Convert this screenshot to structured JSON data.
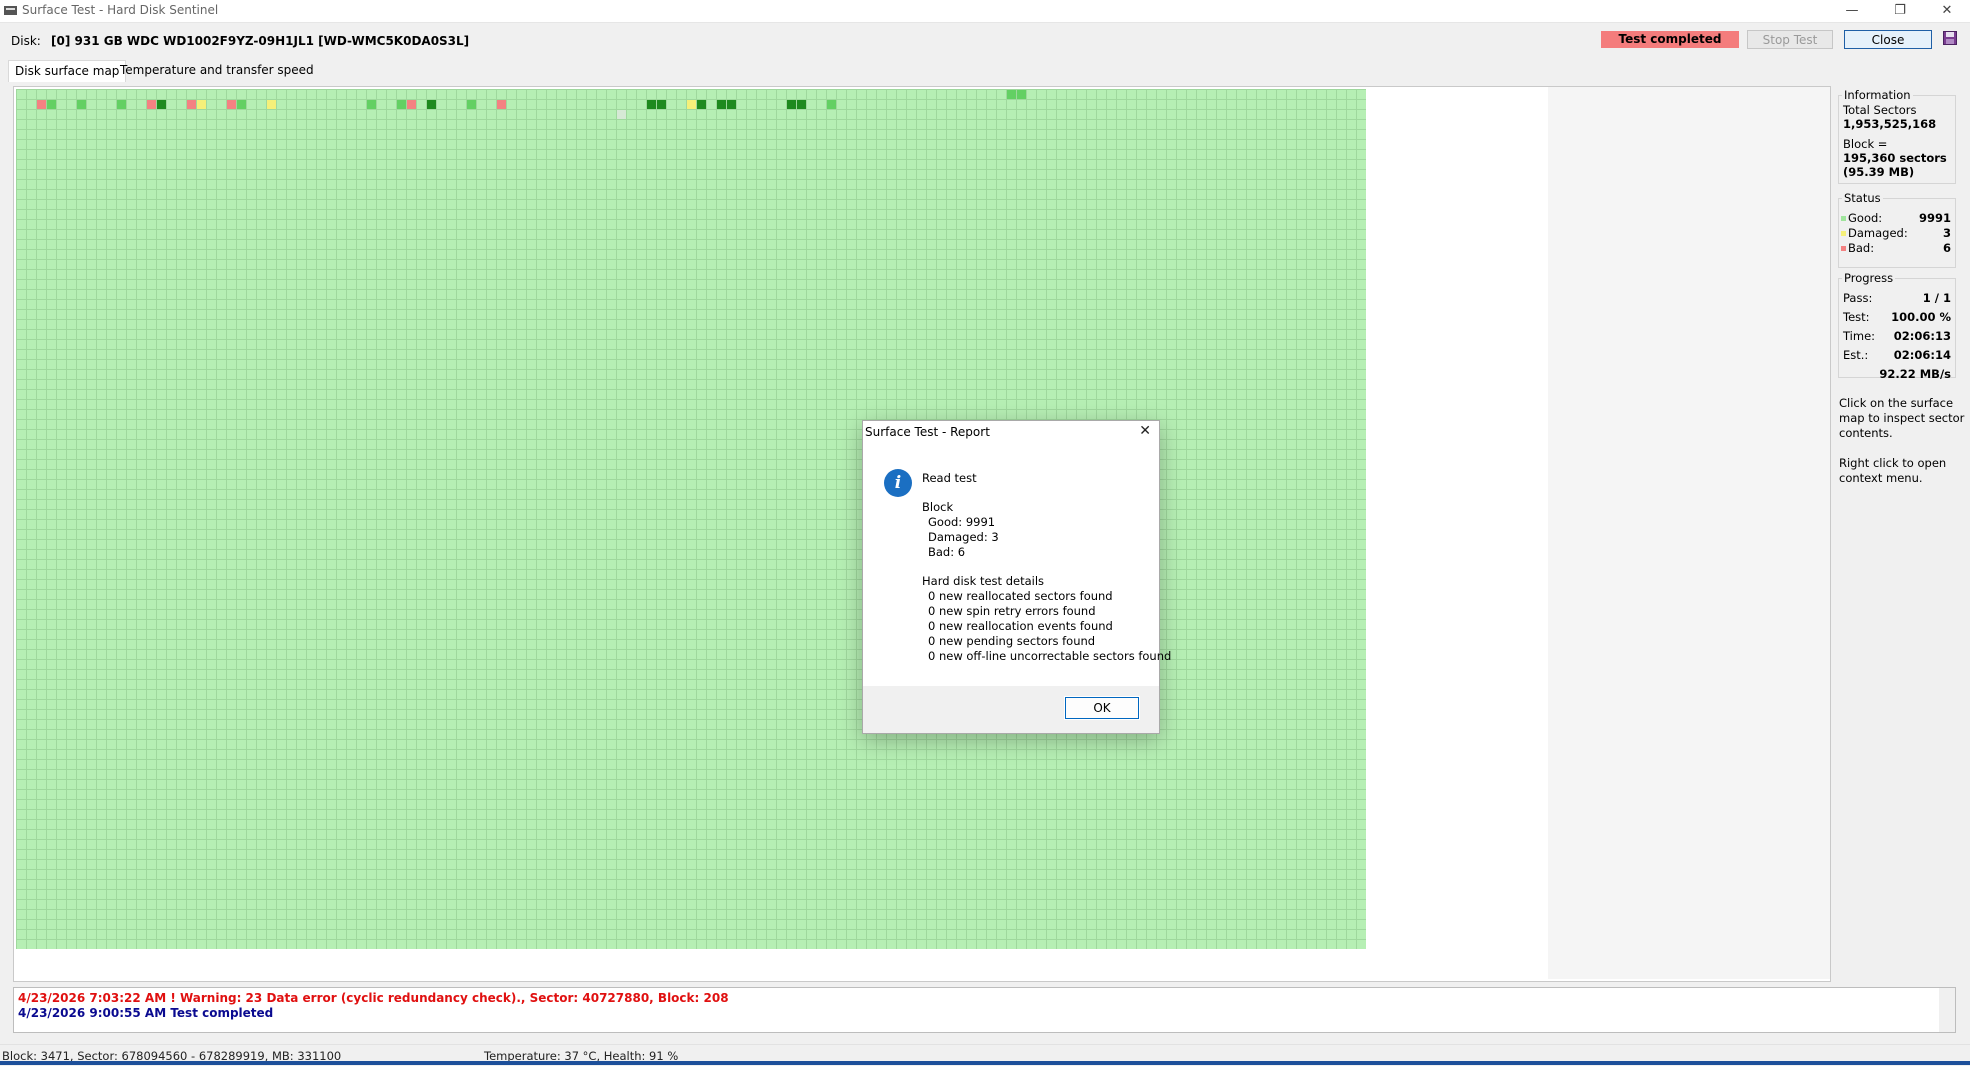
{
  "window": {
    "title": "Surface Test - Hard Disk Sentinel",
    "minimize_glyph": "—",
    "restore_glyph": "❐",
    "close_glyph": "✕"
  },
  "disk": {
    "label": "Disk:",
    "name": "[0] 931 GB  WDC WD1002F9YZ-09H1JL1 [WD-WMC5K0DA0S3L]"
  },
  "toolbar": {
    "status": "Test completed",
    "stop_label": "Stop Test",
    "close_label": "Close",
    "status_color": "#f47c7c"
  },
  "tabs": [
    {
      "label": "Disk surface map",
      "active": true
    },
    {
      "label": "Temperature and transfer speed",
      "active": false
    }
  ],
  "map": {
    "colors": {
      "good": "#b6efb4",
      "good_dark": "#1e8a1e",
      "good_mid": "#63d063",
      "damaged": "#f5f07a",
      "bad": "#f48282"
    }
  },
  "info": {
    "information_title": "Information",
    "total_sectors_label": "Total Sectors",
    "total_sectors": "1,953,525,168",
    "block_label": "Block =",
    "block_sectors": "195,360 sectors",
    "block_mb": "(95.39 MB)",
    "status_title": "Status",
    "good_label": "Good:",
    "good_value": "9991",
    "damaged_label": "Damaged:",
    "damaged_value": "3",
    "bad_label": "Bad:",
    "bad_value": "6",
    "progress_title": "Progress",
    "pass_label": "Pass:",
    "pass_value": "1 / 1",
    "test_label": "Test:",
    "test_value": "100.00 %",
    "time_label": "Time:",
    "time_value": "02:06:13",
    "est_label": "Est.:",
    "est_value": "02:06:14",
    "speed_value": "92.22 MB/s",
    "hint1_line1": "Click on the surface",
    "hint1_line2": "map to inspect sector",
    "hint1_line3": "contents.",
    "hint2_line1": "Right click to open",
    "hint2_line2": "context menu."
  },
  "log": [
    {
      "text": "4/23/2026  7:03:22 AM ! Warning: 23 Data error (cyclic redundancy check)., Sector: 40727880, Block: 208",
      "color": "#e01010"
    },
    {
      "text": "4/23/2026  9:00:55 AM   Test completed",
      "color": "#0a0a90"
    }
  ],
  "statusbar": {
    "block_info": "Block: 3471, Sector: 678094560 - 678289919, MB: 331100",
    "temp_health": "Temperature: 37  °C,  Health: 91 %"
  },
  "dialog": {
    "title": "Surface Test - Report",
    "close_glyph": "✕",
    "icon_glyph": "i",
    "heading": "Read test",
    "block_title": "Block",
    "good": "Good: 9991",
    "damaged": "Damaged: 3",
    "bad": "Bad: 6",
    "details_title": "Hard disk test details",
    "detail1": "0 new reallocated sectors found",
    "detail2": "0 new spin retry errors found",
    "detail3": "0 new reallocation events found",
    "detail4": "0 new pending sectors found",
    "detail5": "0 new off-line uncorrectable sectors found",
    "ok_label": "OK"
  }
}
